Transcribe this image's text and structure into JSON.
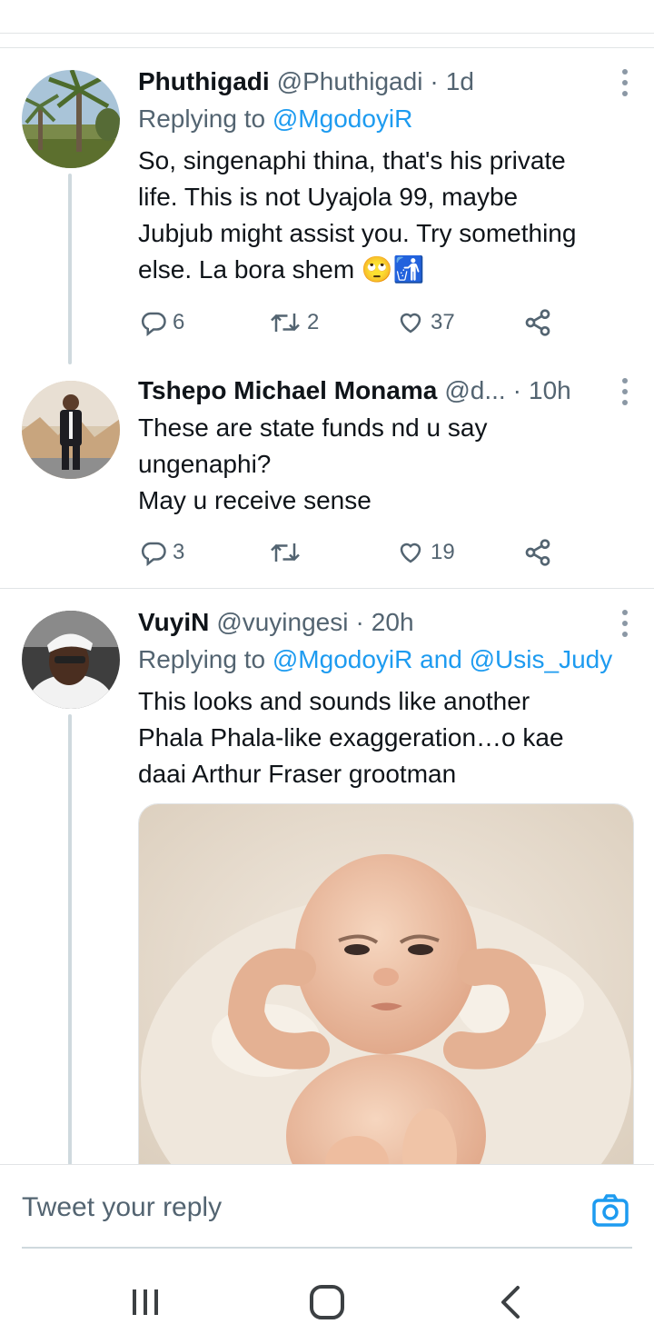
{
  "tweets": [
    {
      "name": "Phuthigadi",
      "handle": "@Phuthigadi",
      "time": "1d",
      "replying_prefix": "Replying to ",
      "replying_to": "@MgodoyiR",
      "lines": [
        "So, singenaphi thina, that's his private",
        "life. This is not Uyajola 99, maybe",
        "Jubjub might assist you. Try something",
        "else. La bora shem 🙄🚮"
      ],
      "replies": "6",
      "retweets": "2",
      "likes": "37"
    },
    {
      "name": "Tshepo Michael Monama",
      "handle": "@d...",
      "time": "10h",
      "lines": [
        "These are state funds nd u say",
        "ungenaphi?",
        "May u receive sense"
      ],
      "replies": "3",
      "retweets": "",
      "likes": "19"
    },
    {
      "name": "VuyiN",
      "handle": "@vuyingesi",
      "time": "20h",
      "replying_prefix": "Replying to ",
      "replying_to": "@MgodoyiR and @Usis_Judy",
      "lines": [
        "This looks and sounds like another",
        "Phala Phala-like exaggeration…o kae",
        "daai Arthur Fraser grootman"
      ]
    }
  ],
  "reply_bar": {
    "placeholder": "Tweet your reply"
  },
  "colors": {
    "accent": "#1d9bf0",
    "muted": "#536471",
    "text": "#0f1419"
  },
  "icons": [
    "reply-icon",
    "retweet-icon",
    "like-icon",
    "share-icon",
    "more-icon",
    "camera-icon",
    "recents-icon",
    "home-icon",
    "back-icon"
  ]
}
